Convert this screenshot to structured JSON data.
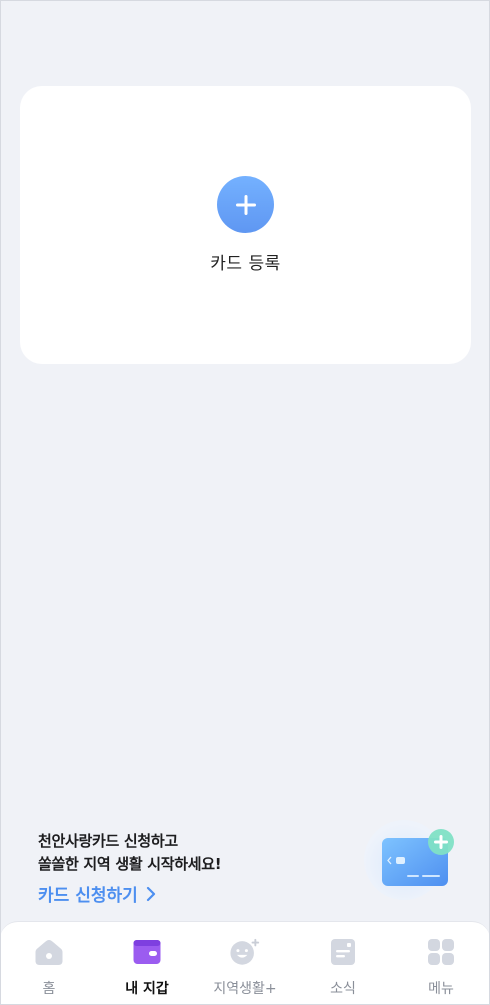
{
  "card_register": {
    "label": "카드 등록",
    "icon": "plus-icon"
  },
  "promo": {
    "line1": "천안사랑카드 신청하고",
    "line2": "쏠쏠한 지역 생활 시작하세요!",
    "link_label": "카드 신청하기",
    "link_icon": "chevron-right-icon"
  },
  "nav": {
    "items": [
      {
        "label": "홈",
        "icon": "home-icon",
        "active": false
      },
      {
        "label": "내 지갑",
        "icon": "wallet-icon",
        "active": true
      },
      {
        "label": "지역생활+",
        "icon": "smile-plus-icon",
        "active": false
      },
      {
        "label": "소식",
        "icon": "news-icon",
        "active": false
      },
      {
        "label": "메뉴",
        "icon": "menu-grid-icon",
        "active": false
      }
    ]
  },
  "colors": {
    "accent": "#5f97f2",
    "link": "#4d8ff0",
    "wallet_active": "#9b5cf0",
    "inactive_icon": "#d3d7e0",
    "background": "#f0f2f7"
  }
}
